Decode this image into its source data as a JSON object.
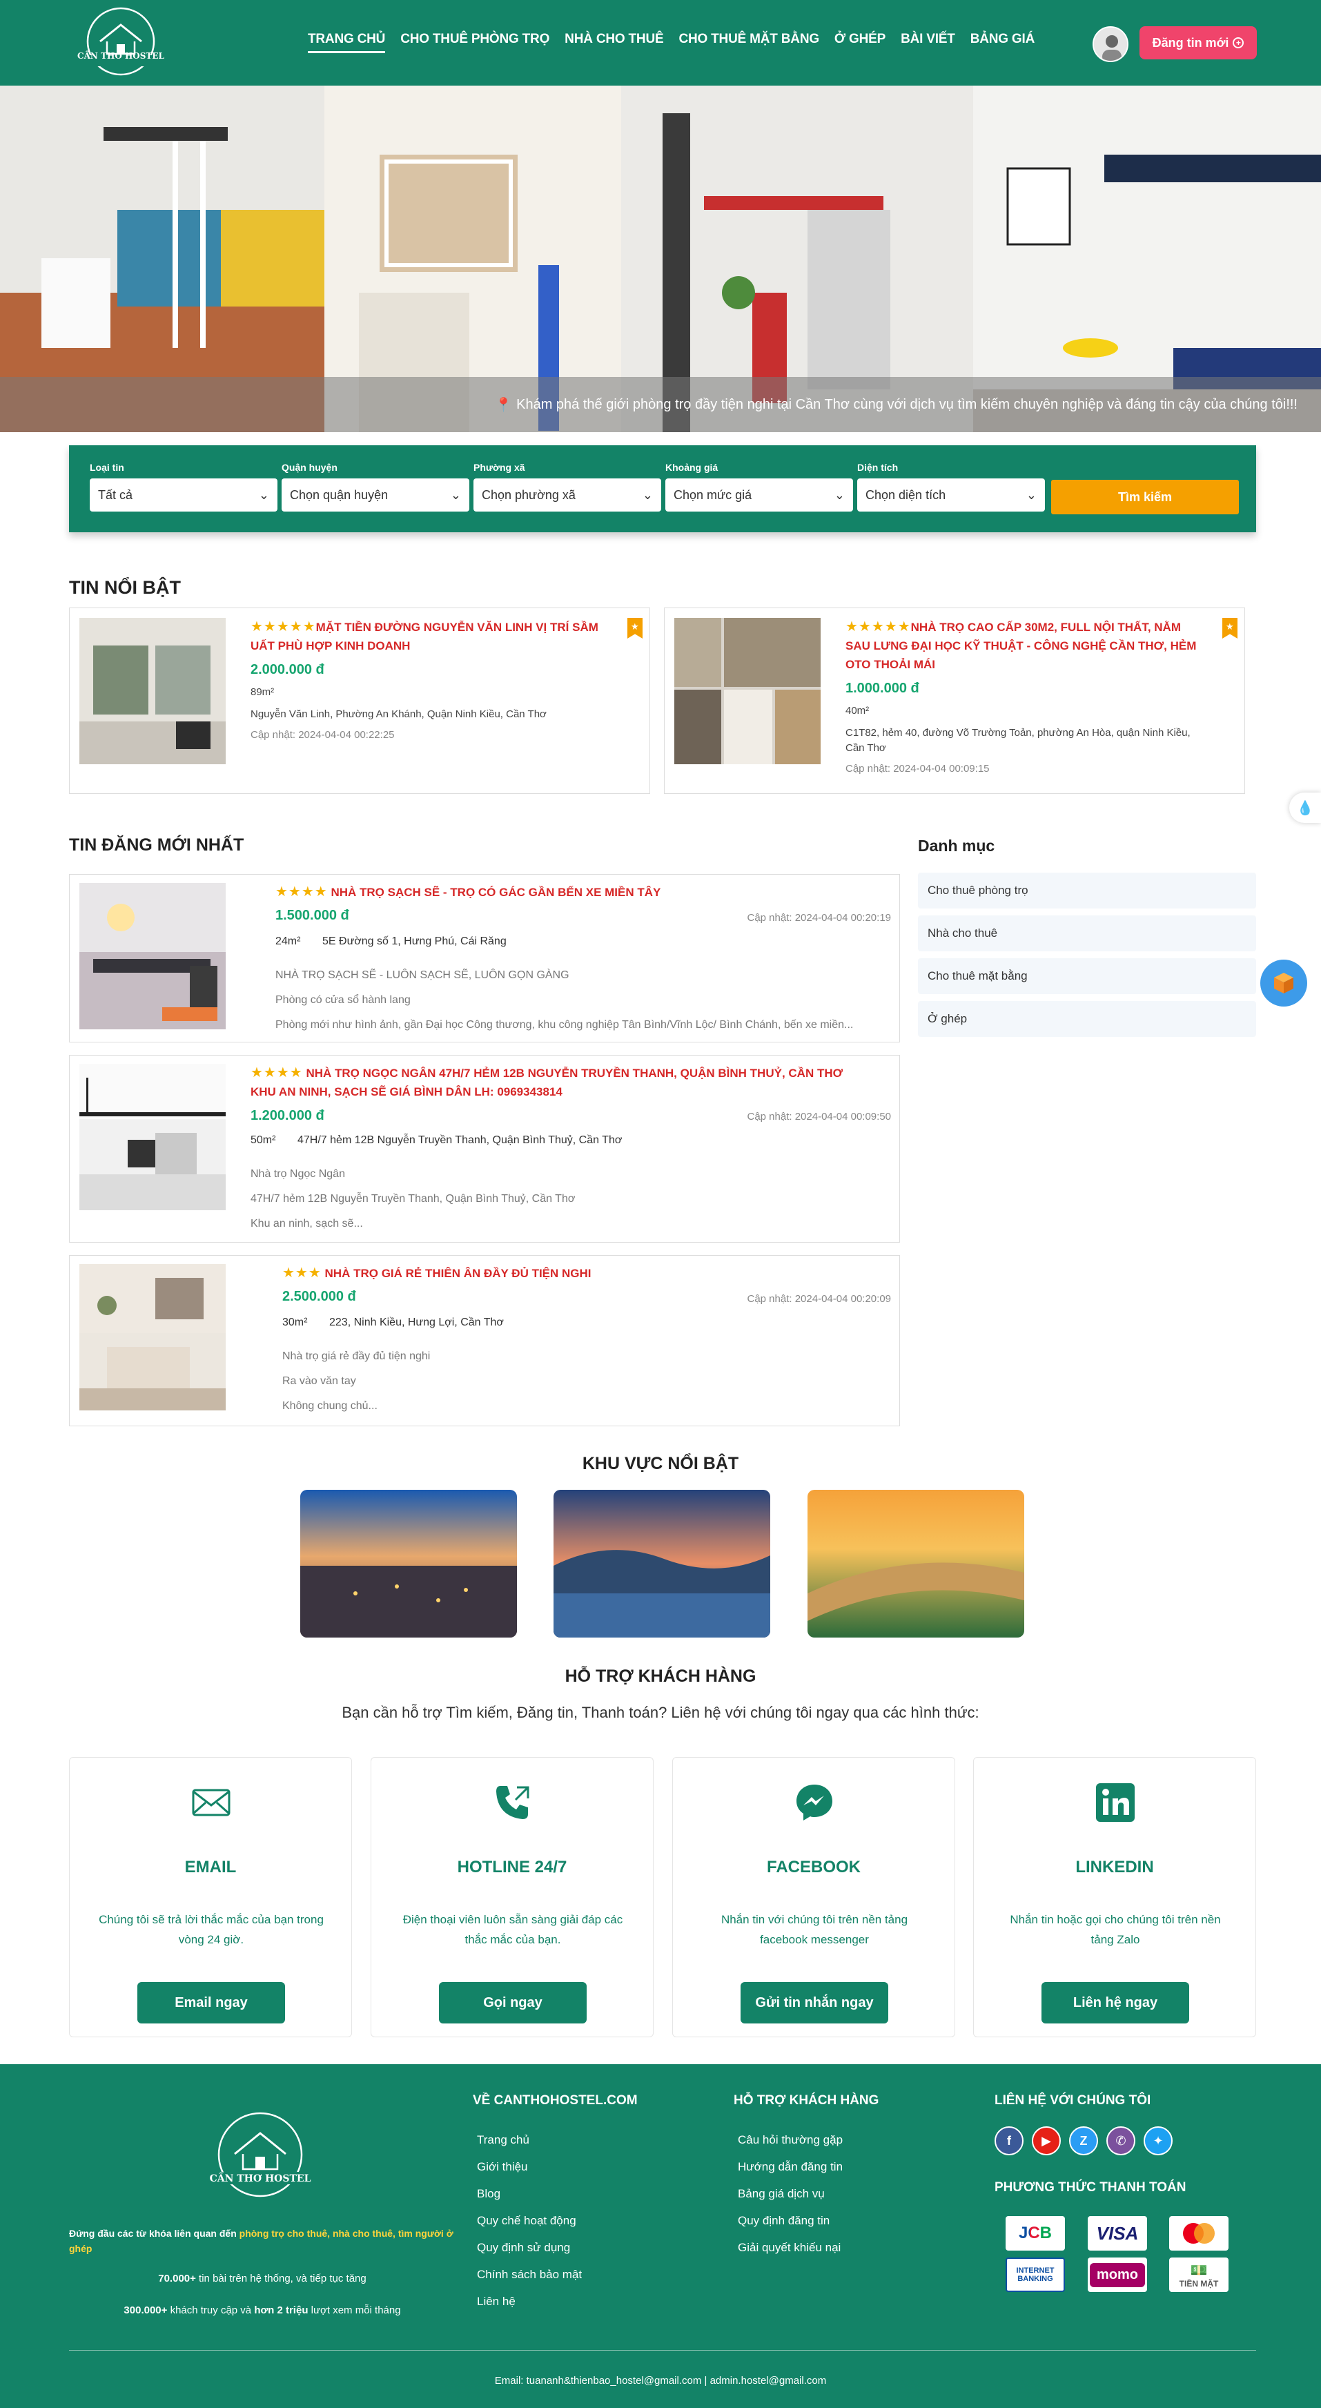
{
  "header": {
    "brand": "CẦN THƠ HOSTEL",
    "nav": [
      "TRANG CHỦ",
      "CHO THUÊ PHÒNG TRỌ",
      "NHÀ CHO THUÊ",
      "CHO THUÊ MẶT BẰNG",
      "Ở GHÉP",
      "BÀI VIẾT",
      "BẢNG GIÁ"
    ],
    "post_button": "Đăng tin mới"
  },
  "hero": {
    "caption": "Khám phá thế giới phòng trọ đầy tiện nghi tại Cần Thơ cùng với dịch vụ tìm kiếm chuyên nghiệp và đáng tin cậy của chúng tôi!!!"
  },
  "search": {
    "fields": [
      {
        "label": "Loại tin",
        "value": "Tất cả"
      },
      {
        "label": "Quận huyện",
        "value": "Chọn quận huyện"
      },
      {
        "label": "Phường xã",
        "value": "Chọn phường xã"
      },
      {
        "label": "Khoảng giá",
        "value": "Chọn mức giá"
      },
      {
        "label": "Diện tích",
        "value": "Chọn diện tích"
      }
    ],
    "button": "Tìm kiếm"
  },
  "featured": {
    "title": "TIN NỔI BẬT",
    "items": [
      {
        "stars": "★★★★★",
        "title": "MẶT TIỀN ĐƯỜNG NGUYỄN VĂN LINH VỊ TRÍ SẦM UẤT PHÙ HỢP KINH DOANH",
        "price": "2.000.000 đ",
        "area": "89m²",
        "address": "Nguyễn Văn Linh, Phường An Khánh, Quận Ninh Kiều, Cần Thơ",
        "updated": "Cập nhật: 2024-04-04 00:22:25"
      },
      {
        "stars": "★★★★★",
        "title": "NHÀ TRỌ CAO CẤP 30M2, FULL NỘI THẤT, NẰM SAU LƯNG ĐẠI HỌC KỸ THUẬT - CÔNG NGHỆ CẦN THƠ, HẺM OTO THOẢI MÁI",
        "price": "1.000.000 đ",
        "area": "40m²",
        "address": "C1T82, hẻm 40, đường Võ Trường Toản, phường An Hòa, quận Ninh Kiều, Cần Thơ",
        "updated": "Cập nhật: 2024-04-04 00:09:15"
      }
    ]
  },
  "latest": {
    "title": "TIN ĐĂNG MỚI NHẤT",
    "items": [
      {
        "stars": "★★★★",
        "title": "NHÀ TRỌ SẠCH SẼ - TRỌ CÓ GÁC GẦN BẾN XE MIỀN TÂY",
        "price": "1.500.000 đ",
        "updated": "Cập nhật: 2024-04-04 00:20:19",
        "area": "24m²",
        "address": "5E Đường số 1, Hưng Phú, Cái Răng",
        "desc": [
          "NHÀ TRỌ SẠCH SẼ - LUÔN SẠCH SẼ, LUÔN GỌN GÀNG",
          "Phòng có cửa sổ hành lang",
          "Phòng mới như hình ảnh, gần Đại học Công thương, khu công nghiệp Tân Bình/Vĩnh Lộc/ Bình Chánh, bến xe miền..."
        ]
      },
      {
        "stars": "★★★★",
        "title": "NHÀ TRỌ NGỌC NGÂN 47H/7 HẺM 12B NGUYỄN TRUYỀN THANH, QUẬN BÌNH THUỶ, CẦN THƠ KHU AN NINH, SẠCH SẼ GIÁ BÌNH DÂN LH: 0969343814",
        "price": "1.200.000 đ",
        "updated": "Cập nhật: 2024-04-04 00:09:50",
        "area": "50m²",
        "address": "47H/7 hẻm 12B Nguyễn Truyền Thanh, Quận Bình Thuỷ, Cần Thơ",
        "desc": [
          "Nhà trọ Ngọc Ngân",
          "47H/7 hẻm 12B Nguyễn Truyền Thanh, Quận Bình Thuỷ, Cần Thơ",
          "Khu an ninh, sạch sẽ..."
        ]
      },
      {
        "stars": "★★★",
        "title": "NHÀ TRỌ GIÁ RẺ THIÊN ÂN ĐẦY ĐỦ TIỆN NGHI",
        "price": "2.500.000 đ",
        "updated": "Cập nhật: 2024-04-04 00:20:09",
        "area": "30m²",
        "address": "223, Ninh Kiều, Hưng Lợi, Cần Thơ",
        "desc": [
          "Nhà trọ giá rẻ đầy đủ tiện nghi",
          "Ra vào văn tay",
          "Không chung chủ..."
        ]
      }
    ]
  },
  "categories": {
    "title": "Danh mục",
    "items": [
      "Cho thuê phòng trọ",
      "Nhà cho thuê",
      "Cho thuê mặt bằng",
      "Ở ghép"
    ]
  },
  "regions": {
    "title": "KHU VỰC NỔI BẬT"
  },
  "support": {
    "title": "HỖ TRỢ KHÁCH HÀNG",
    "subtitle": "Bạn cần hỗ trợ Tìm kiếm, Đăng tin, Thanh toán? Liên hệ với chúng tôi ngay qua các hình thức:",
    "cards": [
      {
        "title": "EMAIL",
        "text": "Chúng tôi sẽ trả lời thắc mắc của bạn trong vòng 24 giờ.",
        "button": "Email ngay"
      },
      {
        "title": "HOTLINE 24/7",
        "text": "Điện thoại viên luôn sẵn sàng giải đáp các thắc mắc của bạn.",
        "button": "Gọi ngay"
      },
      {
        "title": "FACEBOOK",
        "text": "Nhắn tin với chúng tôi trên nền tảng facebook messenger",
        "button": "Gửi tin nhắn ngay"
      },
      {
        "title": "LINKEDIN",
        "text": "Nhắn tin hoặc gọi cho chúng tôi trên nền tảng Zalo",
        "button": "Liên hệ ngay"
      }
    ]
  },
  "footer": {
    "brand": "CẦN THƠ HOSTEL",
    "tagline_pre": "Đứng đầu các từ khóa liên quan đến ",
    "tagline_hl": "phòng trọ cho thuê, nhà cho thuê, tìm người ở ghép",
    "stat1_num": "70.000+",
    "stat1_text": " tin bài trên hệ thống, và tiếp tục tăng",
    "stat2_num": "300.000+",
    "stat2_mid": " khách truy cập và ",
    "stat2_bold": "hơn 2 triệu",
    "stat2_end": " lượt xem mỗi tháng",
    "about_title": "VỀ CANTHOHOSTEL.COM",
    "about_links": [
      "Trang chủ",
      "Giới thiệu",
      "Blog",
      "Quy chế hoạt động",
      "Quy định sử dụng",
      "Chính sách bảo mật",
      "Liên hệ"
    ],
    "help_title": "HỖ TRỢ KHÁCH HÀNG",
    "help_links": [
      "Câu hỏi thường gặp",
      "Hướng dẫn đăng tin",
      "Bảng giá dịch vụ",
      "Quy định đăng tin",
      "Giải quyết khiếu nại"
    ],
    "contact_title": "LIÊN HỆ VỚI CHÚNG TÔI",
    "payment_title": "PHƯƠNG THỨC THANH TOÁN",
    "payments": [
      "JCB",
      "VISA",
      "",
      "INTERNET BANKING",
      "momo",
      "TIỀN MẶT"
    ],
    "email_line": "Email: tuananh&thienbao_hostel@gmail.com | admin.hostel@gmail.com"
  }
}
